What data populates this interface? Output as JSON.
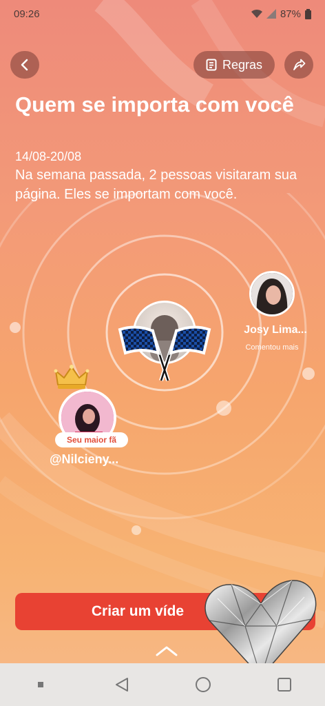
{
  "status": {
    "time": "09:26",
    "battery": "87%"
  },
  "header": {
    "rules_label": "Regras"
  },
  "main": {
    "title": "Quem se importa com você",
    "date_range": "14/08-20/08",
    "description": "Na semana passada, 2 pessoas visitaram sua página. Eles se importam com você."
  },
  "visitors": {
    "josy": {
      "name": "Josy Lima...",
      "subtitle": "Comentou mais"
    },
    "nilcieny": {
      "badge": "Seu maior fã",
      "name": "@Nilcieny..."
    }
  },
  "cta": {
    "label": "Criar um víde"
  },
  "icons": {
    "back": "chevron-left-icon",
    "rules": "document-icon",
    "share": "share-arrow-icon",
    "flags": "checkered-flags-icon",
    "crown": "crown-icon",
    "expand": "chevron-up-icon",
    "heart": "diamond-heart-sticker"
  },
  "colors": {
    "accent": "#e84233",
    "bg_top": "#ee8a7a",
    "bg_bottom": "#f7b98a"
  }
}
